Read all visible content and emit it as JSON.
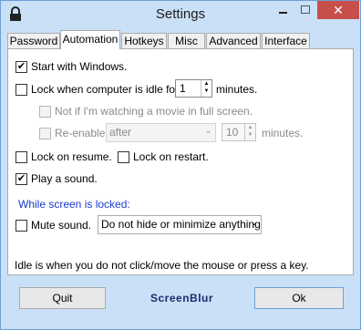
{
  "window": {
    "title": "Settings",
    "close_glyph": "✕"
  },
  "tabs": [
    {
      "label": "Password",
      "active": false
    },
    {
      "label": "Automation",
      "active": true
    },
    {
      "label": "Hotkeys",
      "active": false
    },
    {
      "label": "Misc",
      "active": false
    },
    {
      "label": "Advanced",
      "active": false
    },
    {
      "label": "Interface",
      "active": false
    }
  ],
  "automation": {
    "start_with_windows": {
      "label": "Start with Windows.",
      "checked": true
    },
    "lock_idle": {
      "label": "Lock when computer is idle for",
      "checked": false,
      "minutes": "1",
      "unit": "minutes."
    },
    "not_if_movie": {
      "label": "Not if I'm watching a movie in full screen.",
      "checked": false
    },
    "reenable": {
      "label": "Re-enable",
      "checked": false,
      "mode": "after",
      "minutes": "10",
      "unit": "minutes."
    },
    "lock_on_resume": {
      "label": "Lock on resume.",
      "checked": false
    },
    "lock_on_restart": {
      "label": "Lock on restart.",
      "checked": false
    },
    "play_sound": {
      "label": "Play a sound.",
      "checked": true
    },
    "while_locked_heading": "While screen is locked:",
    "mute_sound": {
      "label": "Mute sound.",
      "checked": false
    },
    "hide_mode": {
      "value": "Do not hide or minimize anything"
    },
    "idle_note": "Idle is when you do not click/move the mouse or press a key."
  },
  "footer": {
    "quit_label": "Quit",
    "brand": "ScreenBlur",
    "ok_label": "Ok"
  },
  "icons": {
    "check": "✔",
    "arrow_up": "▲",
    "arrow_down": "▼",
    "combo_arrow": "⌄"
  }
}
